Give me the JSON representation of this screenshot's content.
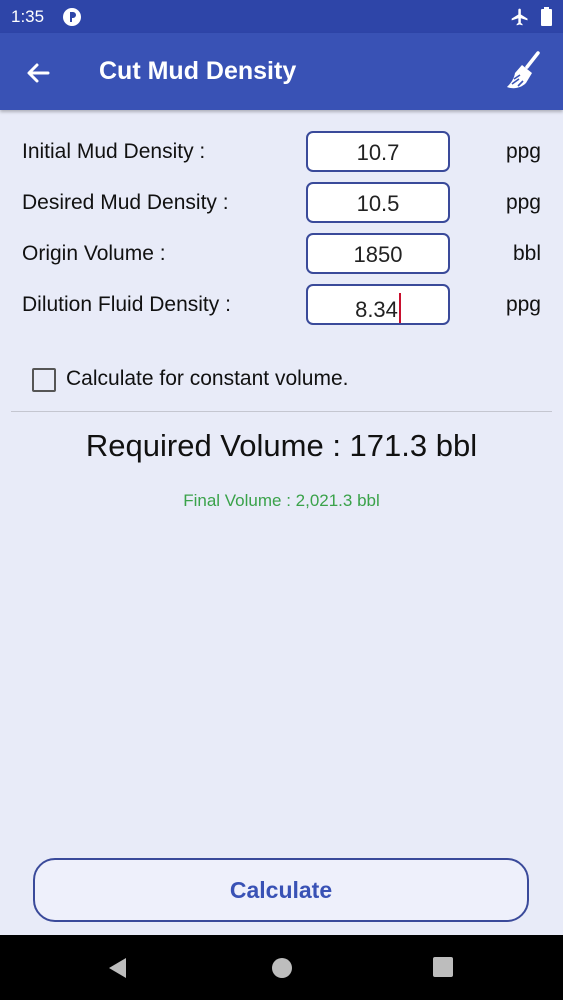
{
  "status_bar": {
    "time": "1:35"
  },
  "app_bar": {
    "title": "Cut Mud Density"
  },
  "fields": [
    {
      "label": "Initial Mud Density :",
      "value": "10.7",
      "unit": "ppg"
    },
    {
      "label": "Desired Mud Density :",
      "value": "10.5",
      "unit": "ppg"
    },
    {
      "label": "Origin Volume :",
      "value": "1850",
      "unit": "bbl"
    },
    {
      "label": "Dilution Fluid Density :",
      "value": "8.34",
      "unit": "ppg"
    }
  ],
  "constant_volume": {
    "label": "Calculate for constant volume.",
    "checked": false
  },
  "result": {
    "required": "Required Volume : 171.3 bbl",
    "final": "Final Volume : 2,021.3 bbl"
  },
  "calculate_button": {
    "label": "Calculate"
  },
  "colors": {
    "app_bar": "#3952b5",
    "status_bar": "#2e45a8",
    "background": "#e8ebf8",
    "final_text": "#3aa24a",
    "caret": "#c8102e"
  },
  "icons": {
    "back": "arrow-back-icon",
    "clear": "broom-icon",
    "airplane": "airplane-icon",
    "battery": "battery-icon"
  }
}
